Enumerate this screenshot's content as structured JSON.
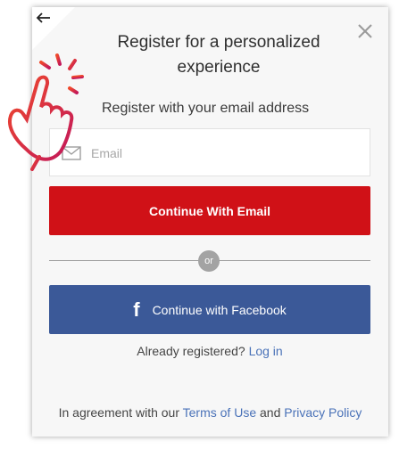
{
  "dialog": {
    "title": "Register for a personalized experience",
    "subtitle": "Register with your email address",
    "email_placeholder": "Email",
    "continue_email_label": "Continue With Email",
    "divider_text": "or",
    "facebook_icon_glyph": "f",
    "continue_facebook_label": "Continue with Facebook",
    "already_registered_text": "Already registered?",
    "login_link": "Log in",
    "agreement_prefix": "In agreement with our",
    "terms_link": "Terms of Use",
    "agreement_and": "and",
    "privacy_link": "Privacy Policy"
  },
  "icons": {
    "back": "arrow-left-icon",
    "close": "close-icon",
    "email": "envelope-icon",
    "facebook": "facebook-icon",
    "pointer": "tap-hand-icon"
  },
  "colors": {
    "email_button": "#d01117",
    "facebook_button": "#3b5998",
    "link": "#4a72b8",
    "hand_gradient_start": "#f04a2b",
    "hand_gradient_end": "#c2185b"
  }
}
